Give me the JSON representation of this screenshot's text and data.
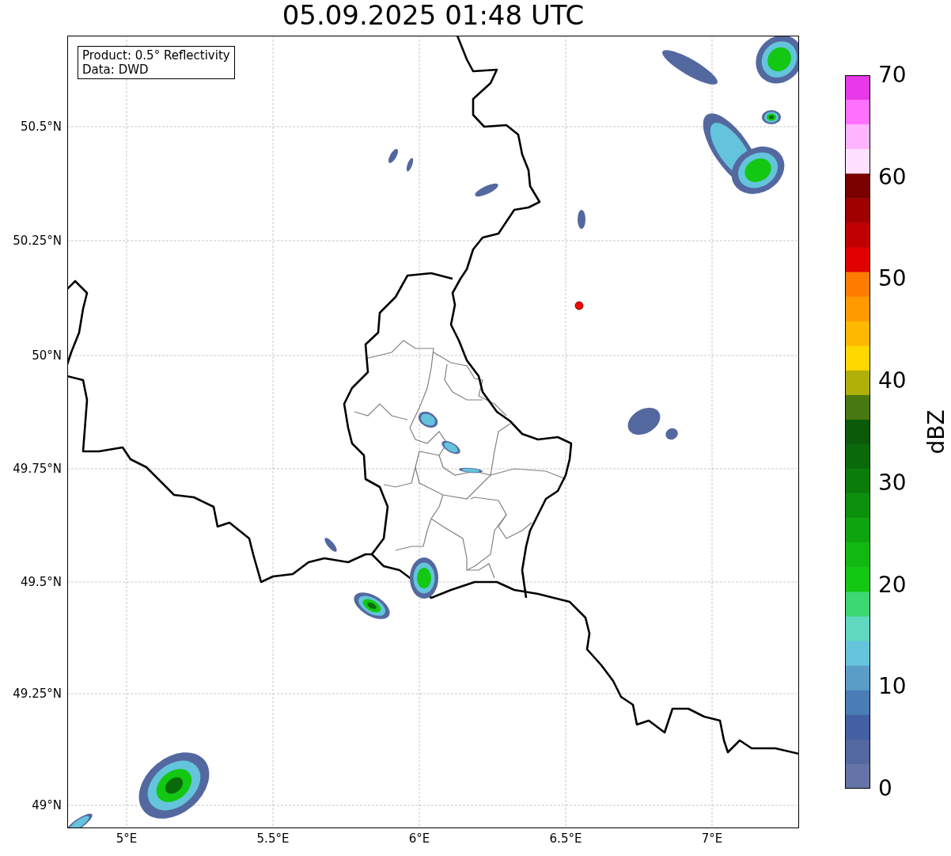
{
  "title": "05.09.2025 01:48 UTC",
  "map": {
    "legend": [
      "Product: 0.5° Reflectivity",
      "Data: DWD"
    ],
    "latitude_labels": [
      "50.5°N",
      "50.25°N",
      "50°N",
      "49.75°N",
      "49.5°N",
      "49.25°N",
      "49°N"
    ],
    "longitude_labels": [
      "5°E",
      "5.5°E",
      "6°E",
      "6.5°E",
      "7°E"
    ]
  },
  "colorbar": {
    "label": "dBZ",
    "ticks": [
      "70",
      "60",
      "50",
      "40",
      "30",
      "20",
      "10",
      "0"
    ],
    "bins": [
      {
        "color": "#e838e8"
      },
      {
        "color": "#ff70ff"
      },
      {
        "color": "#ffb4ff"
      },
      {
        "color": "#ffe0ff"
      },
      {
        "color": "#7a0000"
      },
      {
        "color": "#a00000"
      },
      {
        "color": "#c00000"
      },
      {
        "color": "#e00000"
      },
      {
        "color": "#ff7c00"
      },
      {
        "color": "#ff9a00"
      },
      {
        "color": "#ffb800"
      },
      {
        "color": "#ffd800"
      },
      {
        "color": "#b0b008"
      },
      {
        "color": "#487810"
      },
      {
        "color": "#0a5a0a"
      },
      {
        "color": "#0a6a0a"
      },
      {
        "color": "#0a7c0a"
      },
      {
        "color": "#0c900c"
      },
      {
        "color": "#0ea40e"
      },
      {
        "color": "#10b810"
      },
      {
        "color": "#12c812"
      },
      {
        "color": "#3cd870"
      },
      {
        "color": "#60d8c0"
      },
      {
        "color": "#64c4dc"
      },
      {
        "color": "#5a9ec8"
      },
      {
        "color": "#4a7db5"
      },
      {
        "color": "#4460a4"
      },
      {
        "color": "#5468a0"
      },
      {
        "color": "#6474a8"
      }
    ]
  }
}
